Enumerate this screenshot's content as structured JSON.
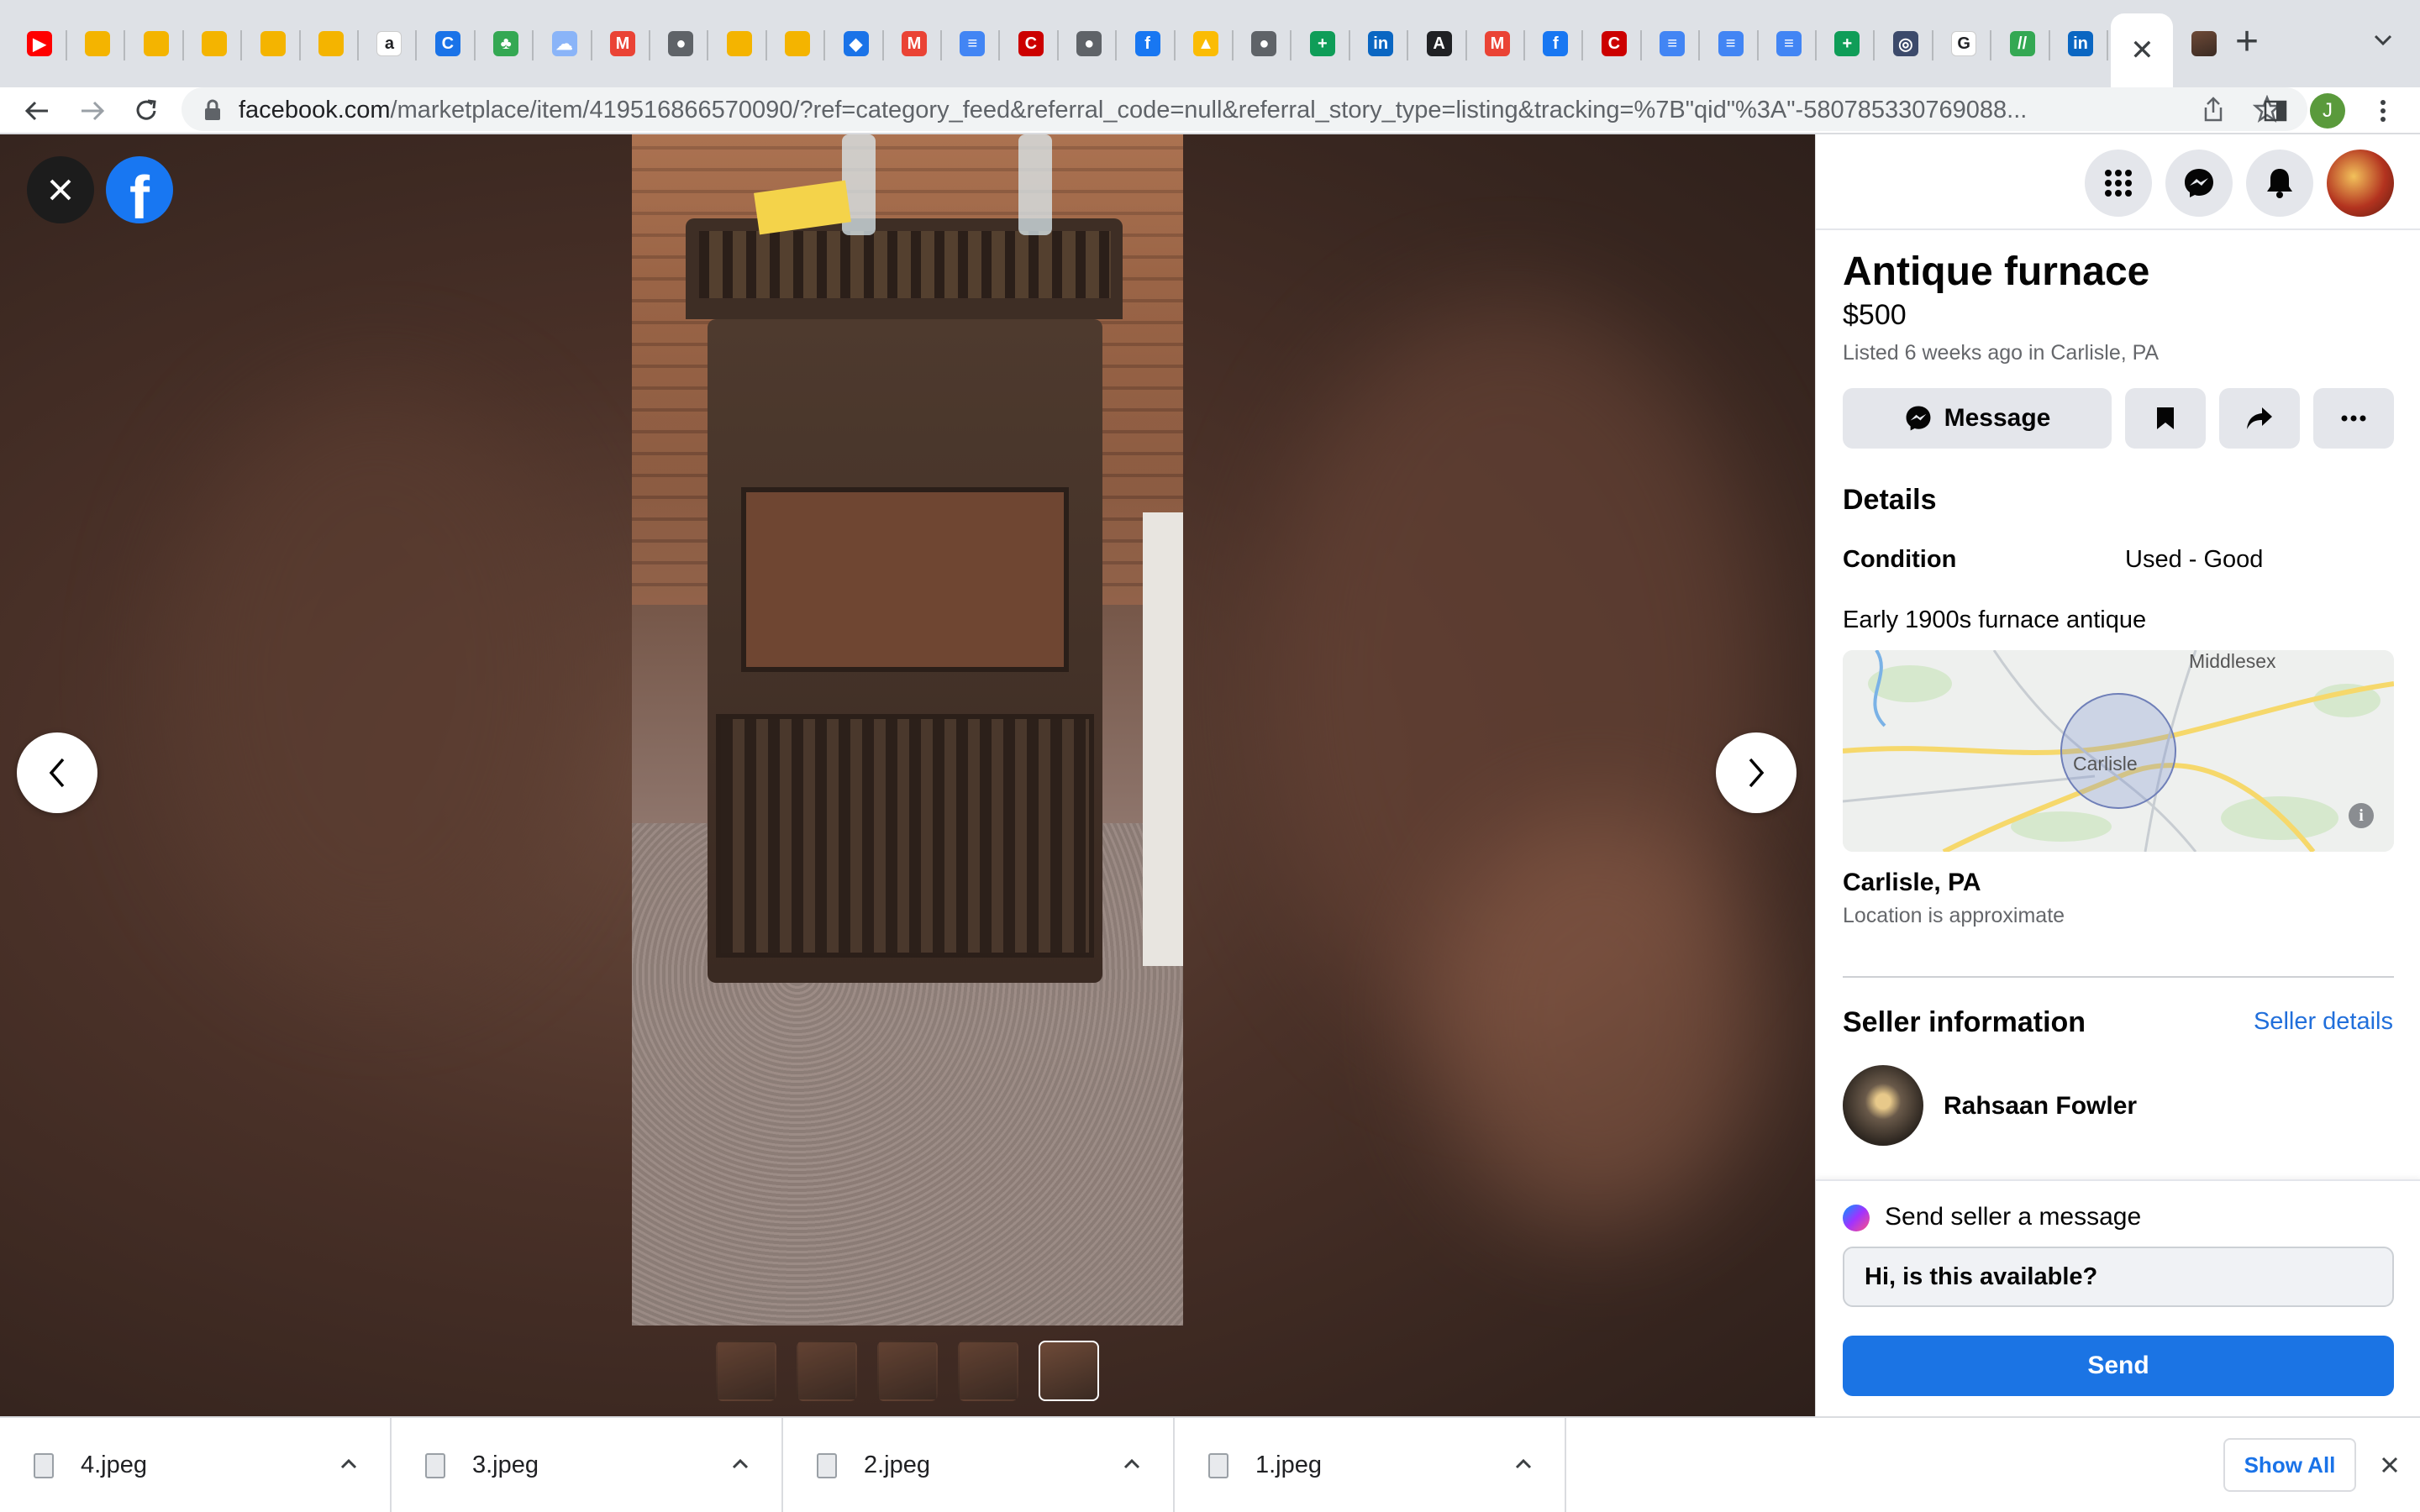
{
  "browser": {
    "url_host": "facebook.com",
    "url_path": "/marketplace/item/419516866570090/?ref=category_feed&referral_code=null&referral_story_type=listing&tracking=%7B\"qid\"%3A\"-580785330769088...",
    "tabs": [
      {
        "icon": "youtube-icon",
        "color": "#ff0000",
        "glyph": "▶"
      },
      {
        "icon": "shopping-bag-icon",
        "color": "#f4b400",
        "glyph": ""
      },
      {
        "icon": "shopping-bag-icon",
        "color": "#f4b400",
        "glyph": ""
      },
      {
        "icon": "shopping-bag-icon",
        "color": "#f4b400",
        "glyph": ""
      },
      {
        "icon": "shopping-bag-icon",
        "color": "#f4b400",
        "glyph": ""
      },
      {
        "icon": "slides-icon",
        "color": "#f4b400",
        "glyph": ""
      },
      {
        "icon": "amazon-icon",
        "color": "#ffffff",
        "glyph": "a"
      },
      {
        "icon": "circle-c-icon",
        "color": "#1a73e8",
        "glyph": "C"
      },
      {
        "icon": "tree-icon",
        "color": "#34a853",
        "glyph": "♣"
      },
      {
        "icon": "cloud-icon",
        "color": "#8ab4f8",
        "glyph": "☁"
      },
      {
        "icon": "gmail-icon",
        "color": "#ea4335",
        "glyph": "M"
      },
      {
        "icon": "globe-icon",
        "color": "#5f6368",
        "glyph": "●"
      },
      {
        "icon": "slides-icon",
        "color": "#f4b400",
        "glyph": ""
      },
      {
        "icon": "slides-icon",
        "color": "#f4b400",
        "glyph": ""
      },
      {
        "icon": "diamond-icon",
        "color": "#1a73e8",
        "glyph": "◆"
      },
      {
        "icon": "gmail-icon",
        "color": "#ea4335",
        "glyph": "M"
      },
      {
        "icon": "docs-icon",
        "color": "#4285f4",
        "glyph": "≡"
      },
      {
        "icon": "cnn-icon",
        "color": "#cc0000",
        "glyph": "C"
      },
      {
        "icon": "globe-icon",
        "color": "#5f6368",
        "glyph": "●"
      },
      {
        "icon": "facebook-icon",
        "color": "#1877f2",
        "glyph": "f"
      },
      {
        "icon": "drive-icon",
        "color": "#fbbc04",
        "glyph": "▲"
      },
      {
        "icon": "globe-icon",
        "color": "#5f6368",
        "glyph": "●"
      },
      {
        "icon": "sheets-icon",
        "color": "#0f9d58",
        "glyph": "+"
      },
      {
        "icon": "linkedin-icon",
        "color": "#0a66c2",
        "glyph": "in"
      },
      {
        "icon": "letter-a-icon",
        "color": "#202124",
        "glyph": "A"
      },
      {
        "icon": "gmail-icon",
        "color": "#ea4335",
        "glyph": "M"
      },
      {
        "icon": "facebook-icon",
        "color": "#1877f2",
        "glyph": "f"
      },
      {
        "icon": "cnn-icon",
        "color": "#cc0000",
        "glyph": "C"
      },
      {
        "icon": "docs-icon",
        "color": "#4285f4",
        "glyph": "≡"
      },
      {
        "icon": "docs-icon",
        "color": "#4285f4",
        "glyph": "≡"
      },
      {
        "icon": "docs-icon",
        "color": "#4285f4",
        "glyph": "≡"
      },
      {
        "icon": "sheets-icon",
        "color": "#0f9d58",
        "glyph": "+"
      },
      {
        "icon": "seal-icon",
        "color": "#3c4a6b",
        "glyph": "◎"
      },
      {
        "icon": "google-icon",
        "color": "#ffffff",
        "glyph": "G"
      },
      {
        "icon": "stripes-icon",
        "color": "#34a853",
        "glyph": "//"
      },
      {
        "icon": "linkedin-icon",
        "color": "#0a66c2",
        "glyph": "in"
      }
    ],
    "active_tab_close": "✕",
    "extra_tab": {
      "icon": "furnace-thumb-icon"
    }
  },
  "listing": {
    "title": "Antique furnace",
    "price": "$500",
    "listed": "Listed 6 weeks ago in Carlisle, PA",
    "message_label": "Message",
    "details_heading": "Details",
    "condition_label": "Condition",
    "condition_value": "Used - Good",
    "description": "Early 1900s furnace antique",
    "map_labels": {
      "town": "Carlisle",
      "region": "Middlesex"
    },
    "location": "Carlisle, PA",
    "location_note": "Location is approximate",
    "seller_heading": "Seller information",
    "seller_details_link": "Seller details",
    "seller_name": "Rahsaan Fowler",
    "send_title": "Send seller a message",
    "send_input_value": "Hi, is this available?",
    "send_button": "Send"
  },
  "downloads": {
    "items": [
      "4.jpeg",
      "3.jpeg",
      "2.jpeg",
      "1.jpeg"
    ],
    "show_all": "Show All"
  },
  "colors": {
    "facebook_blue": "#1877f2",
    "send_blue": "#1b74e4",
    "link_blue": "#216fdb"
  }
}
